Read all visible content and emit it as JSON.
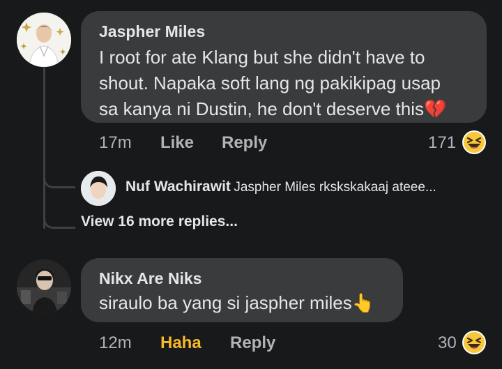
{
  "comments": [
    {
      "author": "Jaspher Miles",
      "line1": "I root for ate Klang but she didn't have to",
      "line2": "shout. Napaka soft lang ng pakikipag usap",
      "line3": "sa kanya ni Dustin, he don't deserve this",
      "line3_emoji": "💔",
      "time": "17m",
      "like_label": "Like",
      "reply_label": "Reply",
      "reaction_count": "171",
      "reaction_icon": "haha-icon"
    },
    {
      "author": "Nikx Are Niks",
      "line1": "siraulo ba yang si jaspher miles",
      "line1_emoji": "👆",
      "time": "12m",
      "like_label": "Haha",
      "reply_label": "Reply",
      "reaction_count": "30",
      "reaction_icon": "haha-icon"
    }
  ],
  "reply_preview": {
    "author": "Nuf Wachirawit",
    "text": "Jaspher Miles rkskskakaaj ateee..."
  },
  "view_more": "View 16 more replies...",
  "colors": {
    "background": "#18191a",
    "bubble": "#3a3b3c",
    "text": "#e4e6eb",
    "meta": "#b0b3b8",
    "haha_active": "#f7b928"
  }
}
